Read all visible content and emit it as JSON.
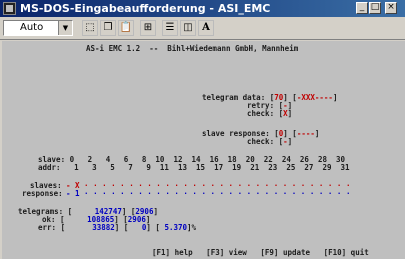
{
  "window": {
    "title": "MS-DOS-Eingabeaufforderung - ASI_EMC",
    "font_select": "Auto",
    "toolbar_icons": [
      "mark-icon",
      "copy-icon",
      "paste-icon",
      "fullscreen-icon",
      "properties-icon",
      "background-icon",
      "font-icon"
    ],
    "min_label": "_",
    "max_label": "□",
    "close_label": "×"
  },
  "console": {
    "header": "AS-i EMC 1.2  --  Bihl+Wiedemann GmbH, Mannheim",
    "telegram_data_label": "telegram data:",
    "telegram_data_val1": "70",
    "telegram_data_val2": "-XXX----",
    "retry_label": "retry:",
    "retry_val": "-",
    "check_label": "check:",
    "check_val": "X",
    "slave_response_label": "slave response:",
    "slave_response_val1": "0",
    "slave_response_val2": "----",
    "check2_label": "check:",
    "check2_val": "-",
    "slave_label": "slave:",
    "slave_numbers": "0   2   4   6   8  10  12  14  16  18  20  22  24  26  28  30",
    "addr_label": "addr:",
    "addr_numbers": "1   3   5   7   9  11  13  15  17  19  21  23  25  27  29  31",
    "slaves_label": "slaves:",
    "slaves_marker": "X",
    "response_label": "response:",
    "response_marker": "1",
    "telegrams_label": "telegrams:",
    "telegrams_val": "142747",
    "telegrams_extra": "2906",
    "ok_label": "ok:",
    "ok_val": "108865",
    "ok_extra": "2906",
    "err_label": "err:",
    "err_val": "33882",
    "err_extra": "0",
    "err_percent": "5.370",
    "footer": "[F1] help   [F3] view   [F9] update   [F10] quit"
  }
}
